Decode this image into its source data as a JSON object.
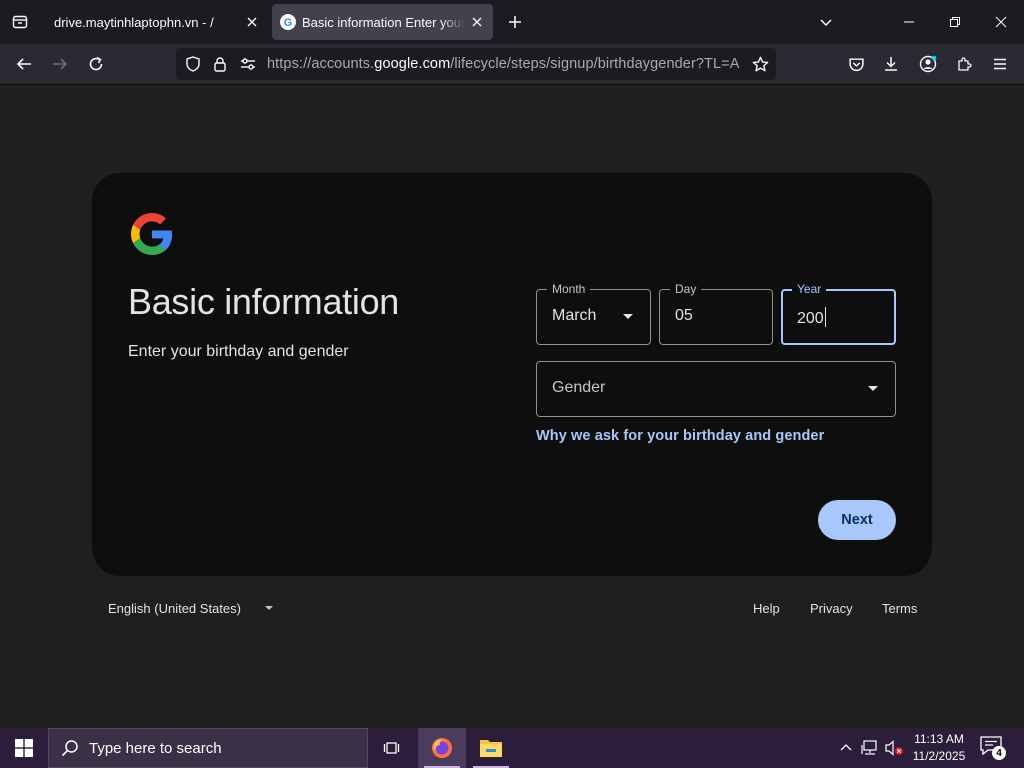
{
  "browser": {
    "tabs": [
      {
        "title": "drive.maytinhlaptophn.vn - /",
        "active": false
      },
      {
        "title": "Basic information Enter your birthday and gender",
        "active": true
      }
    ],
    "url": {
      "prefix": "https://accounts.",
      "domain": "google.com",
      "suffix": "/lifecycle/steps/signup/birthdaygender?TL=ANzg"
    }
  },
  "card": {
    "title": "Basic information",
    "subtitle": "Enter your birthday and gender",
    "month": {
      "label": "Month",
      "value": "March"
    },
    "day": {
      "label": "Day",
      "value": "05"
    },
    "year": {
      "label": "Year",
      "value": "200"
    },
    "gender": {
      "placeholder": "Gender"
    },
    "why_link": "Why we ask for your birthday and gender",
    "next_button": "Next"
  },
  "footer": {
    "language": "English (United States)",
    "help": "Help",
    "privacy": "Privacy",
    "terms": "Terms"
  },
  "taskbar": {
    "search_placeholder": "Type here to search",
    "time": "11:13 AM",
    "date": "11/2/2025",
    "notification_count": "4"
  },
  "colors": {
    "accent": "#a8c7fa",
    "card_bg": "#0e0e0e",
    "page_bg": "#1f1f1f",
    "taskbar_bg": "#2a1e3a"
  }
}
